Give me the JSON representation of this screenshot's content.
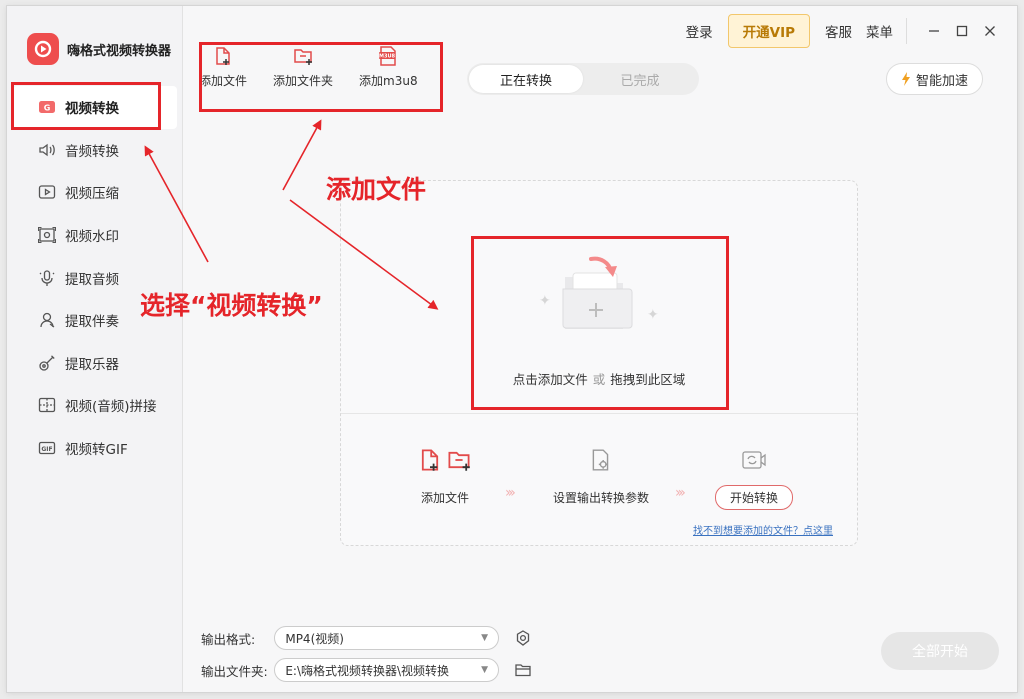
{
  "app": {
    "title": "嗨格式视频转换器"
  },
  "sidebar": {
    "items": [
      {
        "label": "视频转换",
        "icon": "video-convert-icon",
        "active": true
      },
      {
        "label": "音频转换",
        "icon": "speaker-icon"
      },
      {
        "label": "视频压缩",
        "icon": "video-compress-icon"
      },
      {
        "label": "视频水印",
        "icon": "watermark-icon"
      },
      {
        "label": "提取音频",
        "icon": "microphone-icon"
      },
      {
        "label": "提取伴奏",
        "icon": "accompaniment-icon"
      },
      {
        "label": "提取乐器",
        "icon": "guitar-icon"
      },
      {
        "label": "视频(音频)拼接",
        "icon": "merge-icon"
      },
      {
        "label": "视频转GIF",
        "icon": "gif-icon"
      }
    ]
  },
  "toolbar": {
    "add_file": "添加文件",
    "add_folder": "添加文件夹",
    "add_m3u8": "添加m3u8",
    "m3u8_badge": "M3U8"
  },
  "tabs": {
    "converting": "正在转换",
    "done": "已完成"
  },
  "header": {
    "login": "登录",
    "vip": "开通VIP",
    "service": "客服",
    "menu": "菜单",
    "speedup": "智能加速"
  },
  "drop_zone": {
    "click_add": "点击添加文件",
    "or": "或",
    "drag_here": "拖拽到此区域",
    "step1": "添加文件",
    "step2": "设置输出转换参数",
    "step3": "开始转换",
    "help_link": "找不到想要添加的文件？点这里"
  },
  "output": {
    "format_label": "输出格式:",
    "format_value": "MP4(视频)",
    "folder_label": "输出文件夹:",
    "folder_value": "E:\\嗨格式视频转换器\\视频转换"
  },
  "start_all": "全部开始",
  "annotations": {
    "add_file": "添加文件",
    "select_video": "选择“视频转换”"
  },
  "colors": {
    "accent": "#ee4d4d",
    "annotation": "#e5252a",
    "vip_bg": "#fff3d6"
  }
}
